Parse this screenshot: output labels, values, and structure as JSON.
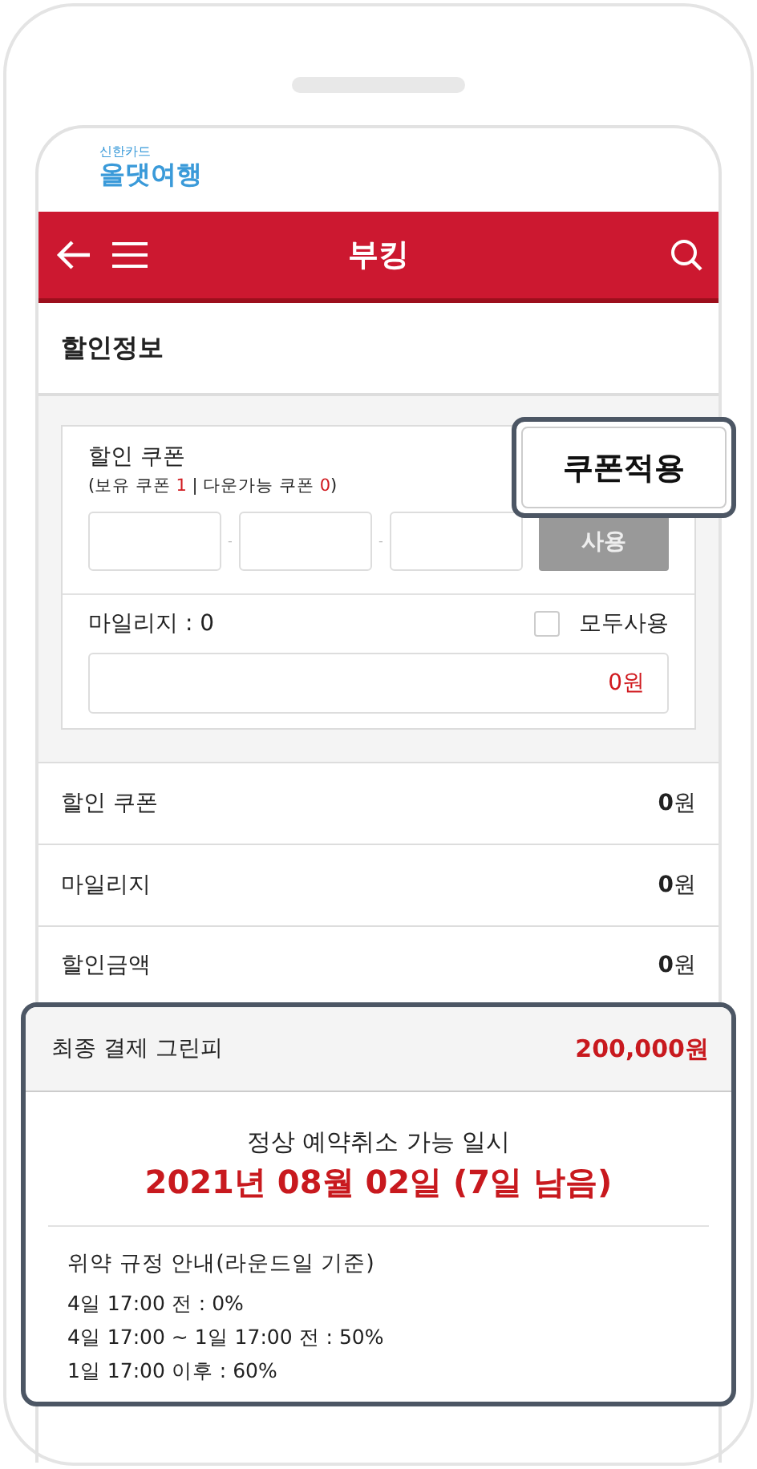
{
  "logo": {
    "brand_small": "신한카드",
    "brand": "올댓여행"
  },
  "header": {
    "title": "부킹"
  },
  "section_title": "할인정보",
  "coupon": {
    "label": "할인 쿠폰",
    "summary": [
      {
        "text": "(보유 쿠폰 ",
        "highlight": false
      },
      {
        "text": "1",
        "highlight": true
      },
      {
        "text": " | 다운가능 쿠폰 ",
        "highlight": false
      },
      {
        "text": "0",
        "highlight": true
      },
      {
        "text": ")",
        "highlight": false
      }
    ],
    "code_fields": [
      {
        "kind": "input"
      },
      {
        "kind": "input"
      },
      {
        "kind": "input"
      }
    ],
    "code_separators": [
      "-",
      "-"
    ],
    "use_button": {
      "label": "사용",
      "disabled": true
    },
    "apply_callout": "쿠폰적용"
  },
  "mileage": {
    "label": "마일리지 : 0",
    "use_all": {
      "label": "모두사용",
      "checked": false
    },
    "value": "0원"
  },
  "rows": [
    {
      "label": "할인 쿠폰",
      "amount": "**0**원"
    },
    {
      "label": "마일리지",
      "amount": "**0**원"
    },
    {
      "label": "할인금액",
      "amount": "**0**원"
    }
  ],
  "final": {
    "label": "최종 결제 그린피",
    "amount": "200,000원"
  },
  "cancel": {
    "title": "정상 예약취소 가능 일시",
    "date": "2021년 08월 02일 (7일 남음)",
    "policy_title": "위약 규정 안내(라운드일 기준)",
    "policy_lines": [
      "4일 17:00 전 : 0%",
      "4일 17:00 ~ 1일 17:00 전 : 50%",
      "1일 17:00 이후 : 60%"
    ]
  }
}
